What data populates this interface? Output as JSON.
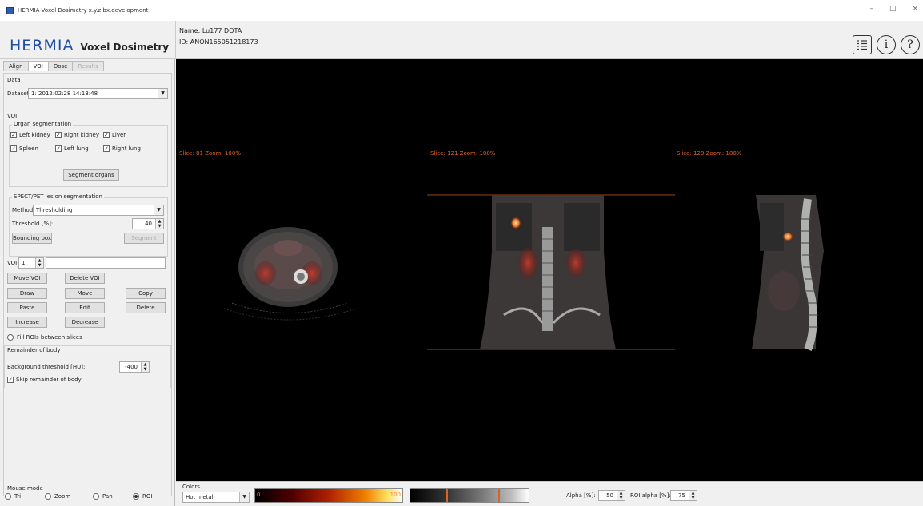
{
  "window": {
    "title": "HERMIA Voxel Dosimetry x.y.z.bx.development",
    "min": "–",
    "max": "□",
    "close": "×"
  },
  "brand": {
    "logo": "HERMIA",
    "product": "Voxel Dosimetry"
  },
  "patient": {
    "name": "Name: Lu177 DOTA",
    "id": "ID: ANON165051218173"
  },
  "header_icons": [
    "list-icon",
    "info-icon",
    "help-icon"
  ],
  "tabs": [
    {
      "label": "Align",
      "active": false,
      "enabled": true
    },
    {
      "label": "VOI",
      "active": true,
      "enabled": true
    },
    {
      "label": "Dose",
      "active": false,
      "enabled": true
    },
    {
      "label": "Results",
      "active": false,
      "enabled": false
    }
  ],
  "data_section": {
    "title": "Data",
    "dataset_label": "Dataset:",
    "dataset_value": "1: 2012:02:28 14:13:48"
  },
  "voi_section": {
    "title": "VOI",
    "organ_title": "Organ segmentation",
    "organs": [
      {
        "label": "Left kidney",
        "checked": true
      },
      {
        "label": "Right kidney",
        "checked": true
      },
      {
        "label": "Liver",
        "checked": true
      },
      {
        "label": "Spleen",
        "checked": true
      },
      {
        "label": "Left lung",
        "checked": true
      },
      {
        "label": "Right lung",
        "checked": true
      }
    ],
    "segment_organs": "Segment organs",
    "lesion_title": "SPECT/PET lesion segmentation",
    "method_label": "Method:",
    "method_value": "Thresholding",
    "threshold_label": "Threshold [%]:",
    "threshold_value": "40",
    "bounding_box": "Bounding box",
    "segment": "Segment",
    "voi_label": "VOI:",
    "voi_value": "1",
    "move_voi": "Move VOI",
    "delete_voi": "Delete VOI",
    "draw": "Draw",
    "move": "Move",
    "copy": "Copy",
    "paste": "Paste",
    "edit": "Edit",
    "delete": "Delete",
    "increase": "Increase",
    "decrease": "Decrease",
    "fill_rois": "Fill ROIs between slices"
  },
  "remainder": {
    "title": "Remainder of body",
    "bg_label": "Background threshold [HU]:",
    "bg_value": "-400",
    "skip_label": "Skip remainder of body",
    "skip_checked": true
  },
  "mouse_mode": {
    "title": "Mouse mode",
    "options": [
      {
        "label": "Tri",
        "selected": false
      },
      {
        "label": "Zoom",
        "selected": false
      },
      {
        "label": "Pan",
        "selected": false
      },
      {
        "label": "ROI",
        "selected": true
      }
    ]
  },
  "views": [
    {
      "label": "Slice: 81 Zoom: 100%"
    },
    {
      "label": "Slice: 121 Zoom: 100%"
    },
    {
      "label": "Slice: 129 Zoom: 100%"
    }
  ],
  "bottom": {
    "colors_label": "Colors",
    "colormap": "Hot metal",
    "bar1_min": "0",
    "bar1_max": "100",
    "bar2_min": "",
    "bar2_max": "",
    "alpha_label": "Alpha [%]:",
    "alpha_value": "50",
    "roi_alpha_label": "ROI alpha [%]:",
    "roi_alpha_value": "75"
  },
  "colors": {
    "brand": "#1e4fa3",
    "slice_label": "#e06020",
    "viewer_bg": "#000000"
  }
}
